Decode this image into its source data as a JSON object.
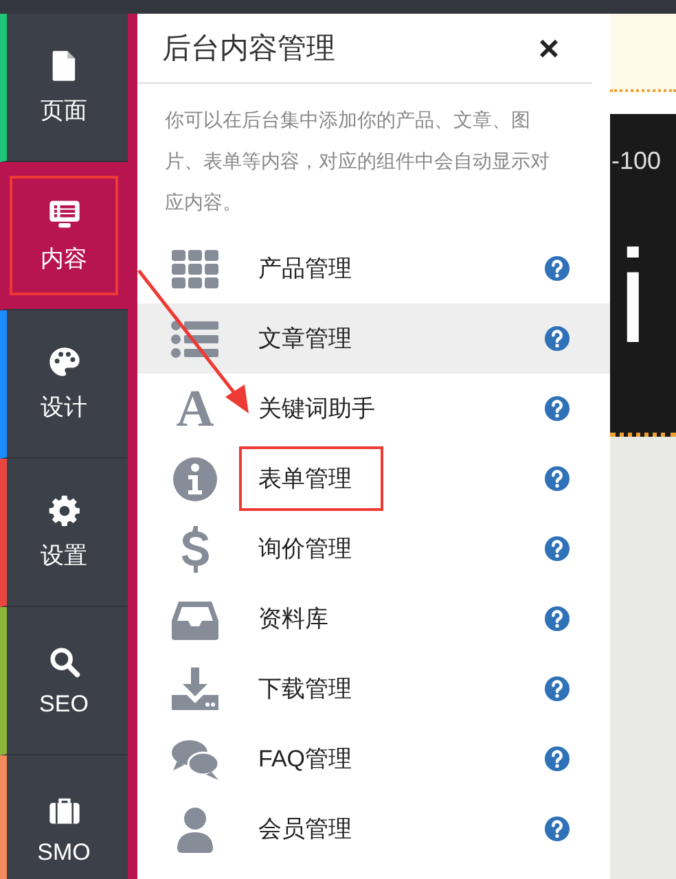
{
  "sidebar": {
    "items": [
      {
        "label": "页面",
        "selected": false,
        "framed": false,
        "color": "#1ec67a"
      },
      {
        "label": "内容",
        "selected": true,
        "framed": true,
        "color": "#b8144f"
      },
      {
        "label": "设计",
        "selected": false,
        "framed": false,
        "color": "#1a8cff"
      },
      {
        "label": "设置",
        "selected": false,
        "framed": false,
        "color": "#e8463f"
      },
      {
        "label": "SEO",
        "selected": false,
        "framed": false,
        "color": "#8db53a"
      },
      {
        "label": "SMO",
        "selected": false,
        "framed": false,
        "color": "#f58a5c"
      }
    ]
  },
  "panel": {
    "title": "后台内容管理",
    "close": "×",
    "description": "你可以在后台集中添加你的产品、文章、图片、表单等内容，对应的组件中会自动显示对应内容。",
    "items": [
      {
        "label": "产品管理",
        "selected": false,
        "framed": false
      },
      {
        "label": "文章管理",
        "selected": true,
        "framed": false
      },
      {
        "label": "关键词助手",
        "selected": false,
        "framed": false,
        "glyph": "A"
      },
      {
        "label": "表单管理",
        "selected": false,
        "framed": true
      },
      {
        "label": "询价管理",
        "selected": false,
        "framed": false
      },
      {
        "label": "资料库",
        "selected": false,
        "framed": false
      },
      {
        "label": "下载管理",
        "selected": false,
        "framed": false
      },
      {
        "label": "FAQ管理",
        "selected": false,
        "framed": false
      },
      {
        "label": "会员管理",
        "selected": false,
        "framed": false
      }
    ]
  },
  "backdrop": {
    "phone": "-100",
    "headline": "i"
  },
  "pointer_arrow": true
}
